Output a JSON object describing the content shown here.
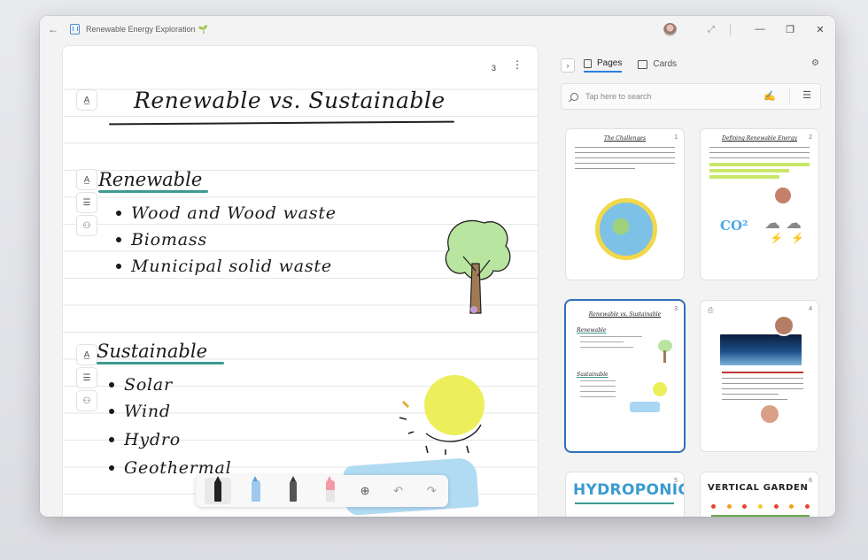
{
  "window": {
    "title": "Renewable Energy Exploration",
    "title_icon": "seedling-icon"
  },
  "canvas": {
    "page_number": "3",
    "title": "Renewable vs. Sustainable",
    "sections": [
      {
        "heading": "Renewable",
        "items": [
          "Wood and Wood waste",
          "Biomass",
          "Municipal solid waste"
        ]
      },
      {
        "heading": "Sustainable",
        "items": [
          "Solar",
          "Wind",
          "Hydro",
          "Geothermal"
        ]
      }
    ]
  },
  "toolbar": {
    "tools": [
      "ballpoint-pen",
      "highlighter",
      "pencil",
      "eraser"
    ],
    "actions": [
      "add-icon",
      "undo-icon",
      "redo-icon"
    ]
  },
  "panel": {
    "tabs": [
      {
        "label": "Pages",
        "active": true
      },
      {
        "label": "Cards",
        "active": false
      }
    ],
    "search_placeholder": "Tap here to search",
    "cards": [
      {
        "num": "1",
        "title": "The Challenges"
      },
      {
        "num": "2",
        "title": "Defining Renewable Energy",
        "annotation": "CO²"
      },
      {
        "num": "3",
        "title": "Renewable vs. Sustainable",
        "sub1": "Renewable",
        "sub2": "Sustainable",
        "selected": true
      },
      {
        "num": "4"
      },
      {
        "num": "5",
        "title": "HYDROPONICS"
      },
      {
        "num": "6",
        "title": "VERTICAL GARDEN"
      }
    ]
  },
  "colors": {
    "accent": "#2b7de0",
    "underline": "#3d9b90",
    "selected_card": "#2f6fb5"
  }
}
